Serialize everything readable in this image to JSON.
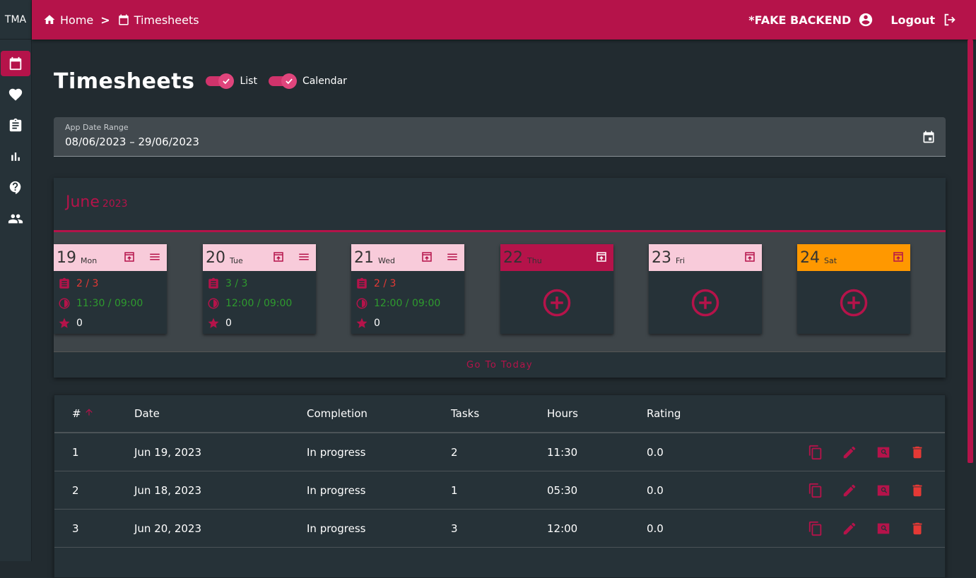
{
  "brand": "TMA",
  "sidebar": {
    "items": [
      "calendar-icon",
      "heart-icon",
      "clipboard-icon",
      "bar-chart-icon",
      "help-icon",
      "people-icon"
    ]
  },
  "breadcrumb": {
    "home": "Home",
    "separator": ">",
    "current": "Timesheets"
  },
  "topbar": {
    "backend": "*FAKE BACKEND",
    "logout": "Logout"
  },
  "page": {
    "title": "Timesheets",
    "toggle_list": "List",
    "toggle_calendar": "Calendar"
  },
  "date_range": {
    "label": "App Date Range",
    "value": "08/06/2023  – 29/06/2023"
  },
  "calendar": {
    "month": "June",
    "year": "2023",
    "days": [
      {
        "num": "19",
        "name": "Mon",
        "tasks": "2 / 3",
        "hours": "11:30 / 09:00",
        "rating": "0",
        "head_color": "#f8cbda"
      },
      {
        "num": "20",
        "name": "Tue",
        "tasks": "3 / 3",
        "hours": "12:00 / 09:00",
        "rating": "0",
        "head_color": "#f8cbda"
      },
      {
        "num": "21",
        "name": "Wed",
        "tasks": "2 / 3",
        "hours": "12:00 / 09:00",
        "rating": "0",
        "head_color": "#f8cbda"
      },
      {
        "num": "22",
        "name": "Thu",
        "head_color": "#b5134a"
      },
      {
        "num": "23",
        "name": "Fri",
        "head_color": "#f8cbda"
      },
      {
        "num": "24",
        "name": "Sat",
        "head_color": "#ff9800"
      }
    ],
    "go_today": "Go To Today"
  },
  "table": {
    "headers": [
      "#",
      "Date",
      "Completion",
      "Tasks",
      "Hours",
      "Rating"
    ],
    "rows": [
      {
        "n": "1",
        "date": "Jun 19, 2023",
        "completion": "In progress",
        "tasks": "2",
        "hours": "11:30",
        "rating": "0.0"
      },
      {
        "n": "2",
        "date": "Jun 18, 2023",
        "completion": "In progress",
        "tasks": "1",
        "hours": "05:30",
        "rating": "0.0"
      },
      {
        "n": "3",
        "date": "Jun 20, 2023",
        "completion": "In progress",
        "tasks": "3",
        "hours": "12:00",
        "rating": "0.0"
      }
    ]
  },
  "colors": {
    "accent": "#b5134a",
    "background": "#222b30",
    "card": "#263238",
    "danger": "#e53935",
    "success": "#2e9b2e"
  }
}
